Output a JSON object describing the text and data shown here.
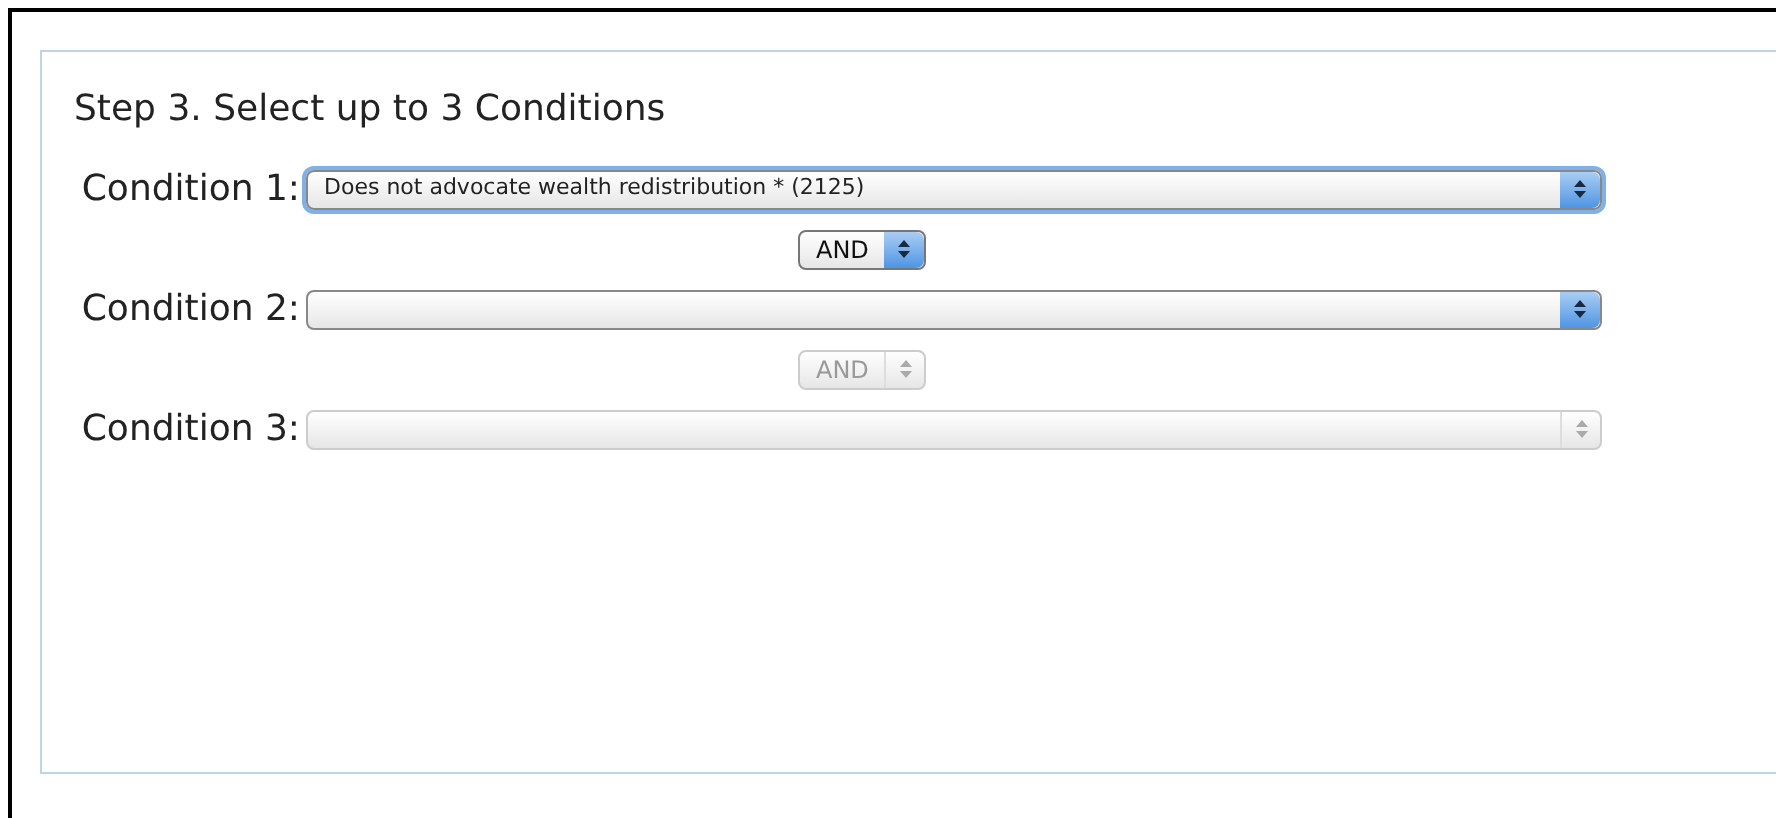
{
  "heading": "Step 3. Select up to 3 Conditions",
  "conditions": [
    {
      "label": "Condition 1:",
      "value": "Does not advocate wealth redistribution * (2125)",
      "focused": true,
      "disabled": false,
      "operator": {
        "label": "AND",
        "disabled": false
      }
    },
    {
      "label": "Condition 2:",
      "focused": false,
      "disabled": false,
      "operator": {
        "label": "AND",
        "disabled": true
      }
    },
    {
      "label": "Condition 3:",
      "focused": false,
      "disabled": true
    }
  ]
}
